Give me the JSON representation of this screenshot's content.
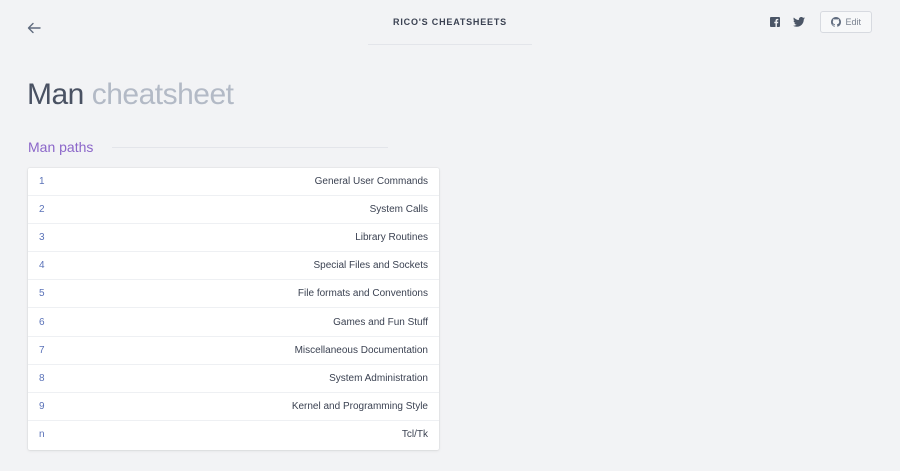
{
  "header": {
    "brand": "RICO'S CHEATSHEETS",
    "edit_label": "Edit"
  },
  "icons": {
    "back": "arrow-left-icon",
    "facebook": "facebook-icon",
    "twitter": "twitter-icon",
    "github": "github-icon"
  },
  "title": {
    "main": "Man",
    "sub": "cheatsheet"
  },
  "section": {
    "heading": "Man paths"
  },
  "table": {
    "rows": [
      {
        "key": "1",
        "value": "General User Commands"
      },
      {
        "key": "2",
        "value": "System Calls"
      },
      {
        "key": "3",
        "value": "Library Routines"
      },
      {
        "key": "4",
        "value": "Special Files and Sockets"
      },
      {
        "key": "5",
        "value": "File formats and Conventions"
      },
      {
        "key": "6",
        "value": "Games and Fun Stuff"
      },
      {
        "key": "7",
        "value": "Miscellaneous Documentation"
      },
      {
        "key": "8",
        "value": "System Administration"
      },
      {
        "key": "9",
        "value": "Kernel and Programming Style"
      },
      {
        "key": "n",
        "value": "Tcl/Tk"
      }
    ]
  },
  "colors": {
    "background": "#f2f3f5",
    "accent": "#8b66c9",
    "link": "#5a72b8",
    "text": "#3b4252"
  }
}
